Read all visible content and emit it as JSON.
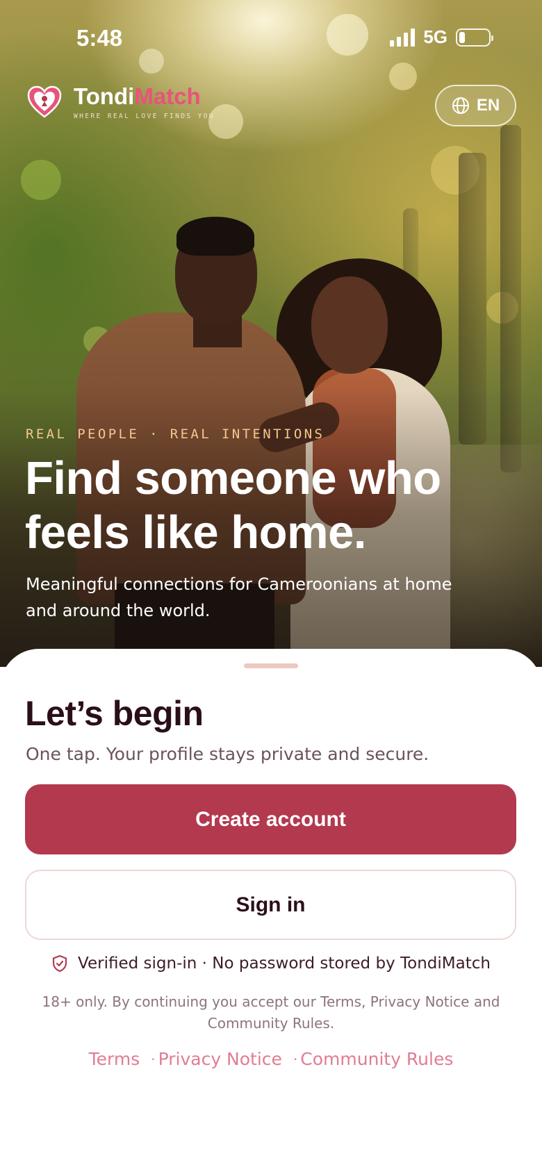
{
  "status_bar": {
    "time": "5:48",
    "network": "5G",
    "icons": [
      "cellular-signal-icon",
      "battery-icon"
    ]
  },
  "brand": {
    "name_part1": "Tondi",
    "name_part2": "Match",
    "tagline": "WHERE REAL LOVE FINDS YOU",
    "logo_icon": "heart-logo-icon"
  },
  "language": {
    "label": "EN",
    "icon": "globe-icon"
  },
  "hero": {
    "eyebrow": "REAL PEOPLE · REAL INTENTIONS",
    "headline_line1": "Find someone who",
    "headline_line2": "feels like home.",
    "subline": "Meaningful connections for Cameroonians at home and around the world."
  },
  "sheet": {
    "title": "Let’s begin",
    "subtitle": "One tap. Your profile stays private and secure.",
    "primary_button": "Create account",
    "secondary_button": "Sign in",
    "verified_text": "Verified sign-in · No password stored by TondiMatch",
    "verified_icon": "shield-check-icon",
    "legal": "18+ only. By continuing you accept our Terms, Privacy Notice and Community Rules.",
    "links": [
      "Terms",
      "Privacy Notice",
      "Community Rules"
    ],
    "link_separator": "·"
  },
  "colors": {
    "accent": "#b3394f",
    "brand_pink": "#e8537a",
    "link_pink": "#e07d95",
    "eyebrow_gold": "#f2c98f",
    "heading_dark": "#2b0f17"
  }
}
